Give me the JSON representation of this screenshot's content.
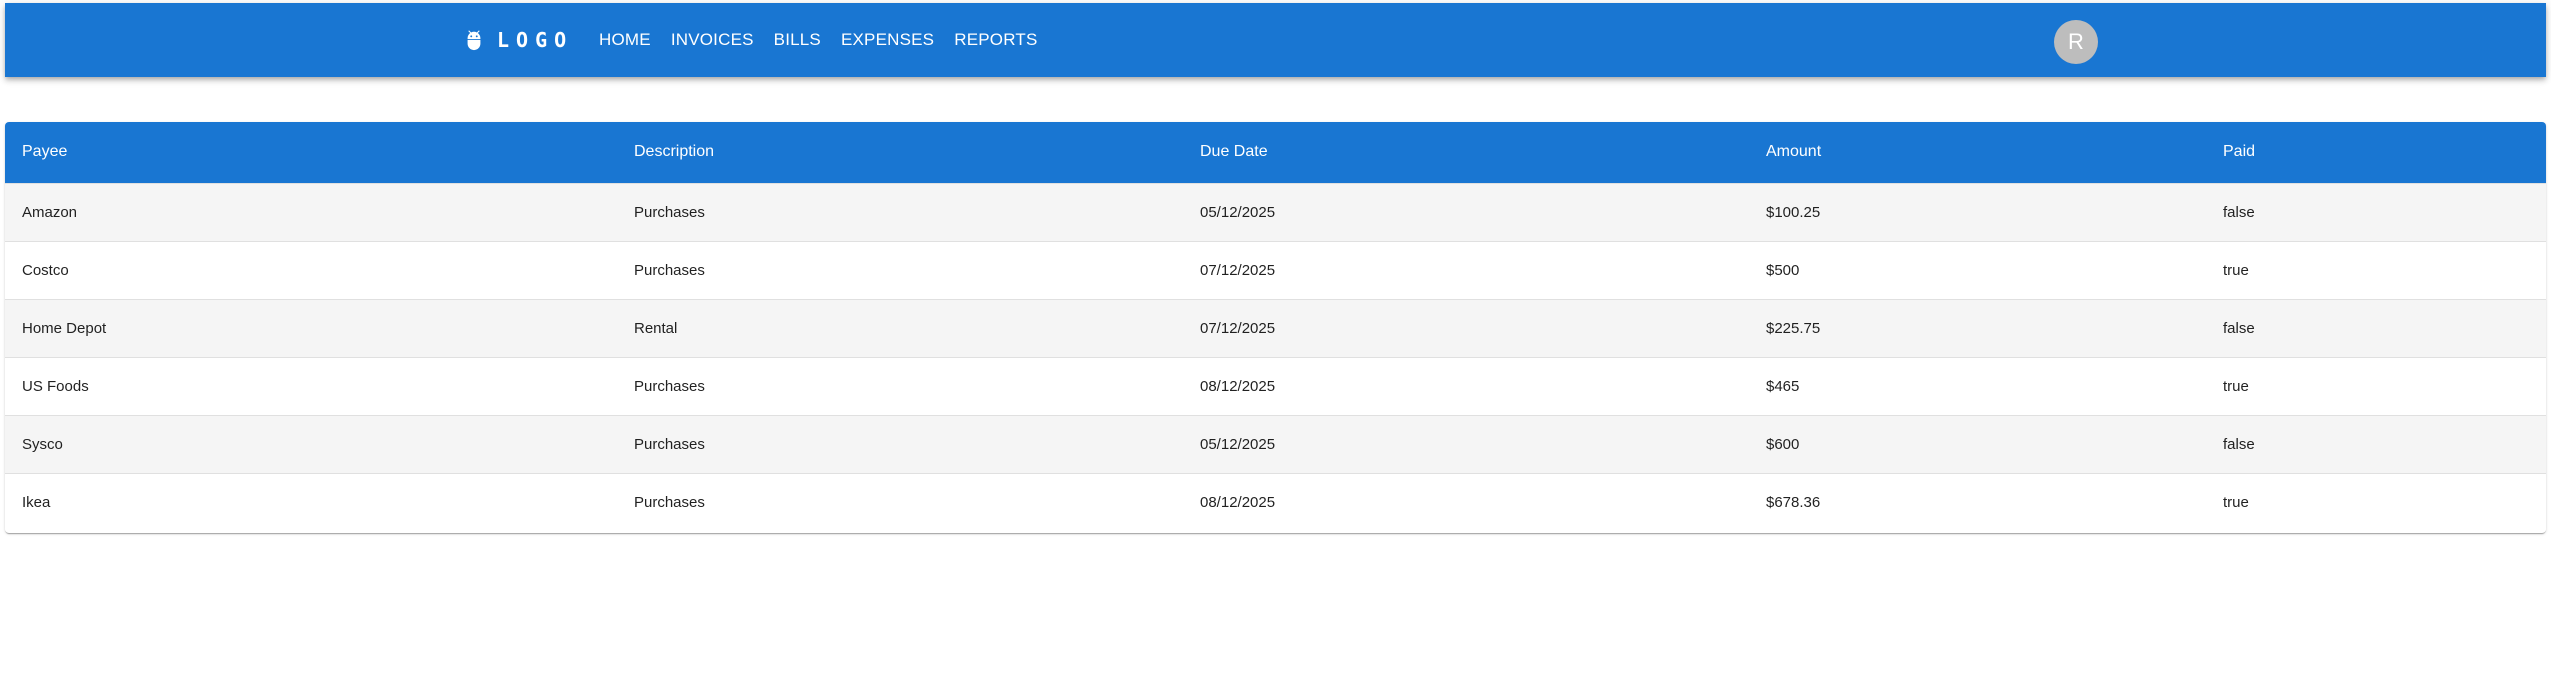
{
  "header": {
    "brand": "LOGO",
    "brand_icon": "adb-icon",
    "nav": [
      "HOME",
      "INVOICES",
      "BILLS",
      "EXPENSES",
      "REPORTS"
    ],
    "avatar_initial": "R",
    "accent_color": "#1976d2"
  },
  "table": {
    "columns": [
      "Payee",
      "Description",
      "Due Date",
      "Amount",
      "Paid"
    ],
    "rows": [
      [
        "Amazon",
        "Purchases",
        "05/12/2025",
        "$100.25",
        "false"
      ],
      [
        "Costco",
        "Purchases",
        "07/12/2025",
        "$500",
        "true"
      ],
      [
        "Home Depot",
        "Rental",
        "07/12/2025",
        "$225.75",
        "false"
      ],
      [
        "US Foods",
        "Purchases",
        "08/12/2025",
        "$465",
        "true"
      ],
      [
        "Sysco",
        "Purchases",
        "05/12/2025",
        "$600",
        "false"
      ],
      [
        "Ikea",
        "Purchases",
        "08/12/2025",
        "$678.36",
        "true"
      ]
    ]
  }
}
